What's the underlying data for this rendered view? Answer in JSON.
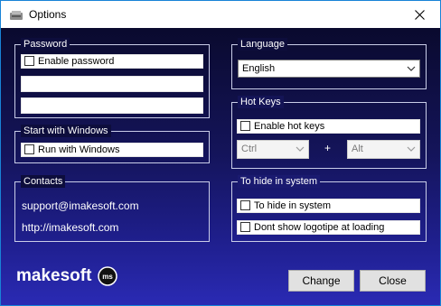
{
  "window": {
    "title": "Options",
    "close_icon": "close-icon",
    "app_icon": "app-icon"
  },
  "password": {
    "group_label": "Password",
    "enable_label": "Enable password",
    "enabled": false,
    "field1_value": "",
    "field2_value": ""
  },
  "start_windows": {
    "group_label": "Start with Windows",
    "run_label": "Run with Windows",
    "checked": false
  },
  "contacts": {
    "group_label": "Contacts",
    "email": "support@imakesoft.com",
    "website": "http://imakesoft.com"
  },
  "language": {
    "group_label": "Language",
    "selected": "English"
  },
  "hotkeys": {
    "group_label": "Hot Keys",
    "enable_label": "Enable hot keys",
    "enabled": false,
    "modifier1": "Ctrl",
    "plus": "+",
    "modifier2": "Alt"
  },
  "hide": {
    "group_label": "To hide in system",
    "hide_label": "To hide in system",
    "logo_label": "Dont show logotipe at loading"
  },
  "logo": {
    "text": "makesoft",
    "badge": "ms"
  },
  "buttons": {
    "change": "Change",
    "close": "Close"
  },
  "colors": {
    "background_top": "#0a0a2e",
    "background_bottom": "#2a2ab4",
    "window_border": "#1883d7"
  }
}
